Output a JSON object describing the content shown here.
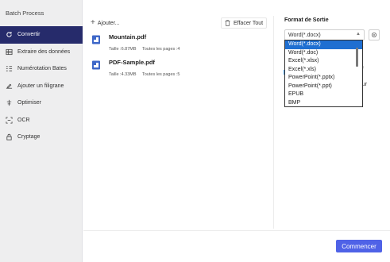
{
  "app": {
    "title": "Batch Process"
  },
  "sidebar": {
    "items": [
      {
        "label": "Convertir",
        "icon": "refresh-icon",
        "active": true
      },
      {
        "label": "Extraire des données",
        "icon": "table-icon"
      },
      {
        "label": "Numérotation Bates",
        "icon": "numbering-icon"
      },
      {
        "label": "Ajouter un filigrane",
        "icon": "watermark-icon"
      },
      {
        "label": "Optimiser",
        "icon": "optimize-icon"
      },
      {
        "label": "OCR",
        "icon": "ocr-icon"
      },
      {
        "label": "Cryptage",
        "icon": "lock-icon"
      }
    ]
  },
  "toolbar": {
    "add_label": "Ajouter...",
    "clear_label": "Effacer Tout"
  },
  "files": [
    {
      "name": "Mountain.pdf",
      "size": "Taille :6.87MB",
      "pages": "Toutes les pages :4"
    },
    {
      "name": "PDF-Sample.pdf",
      "size": "Taille :4.33MB",
      "pages": "Toutes les pages :5"
    }
  ],
  "output": {
    "title": "Format de Sortie",
    "selected": "Word(*.docx)",
    "options": [
      "Word(*.docx)",
      "Word(*.doc)",
      "Excel(*.xlsx)",
      "Excel(*.xls)",
      "PowerPoint(*.pptx)",
      "PowerPoint(*.ppt)",
      "EPUB",
      "BMP"
    ],
    "partial_e": "é",
    "partial_our": "our"
  },
  "footer": {
    "start_label": "Commencer"
  },
  "colors": {
    "sidebar_active": "#262b6b",
    "primary": "#4f62e7",
    "option_selected": "#1f6fd1"
  }
}
